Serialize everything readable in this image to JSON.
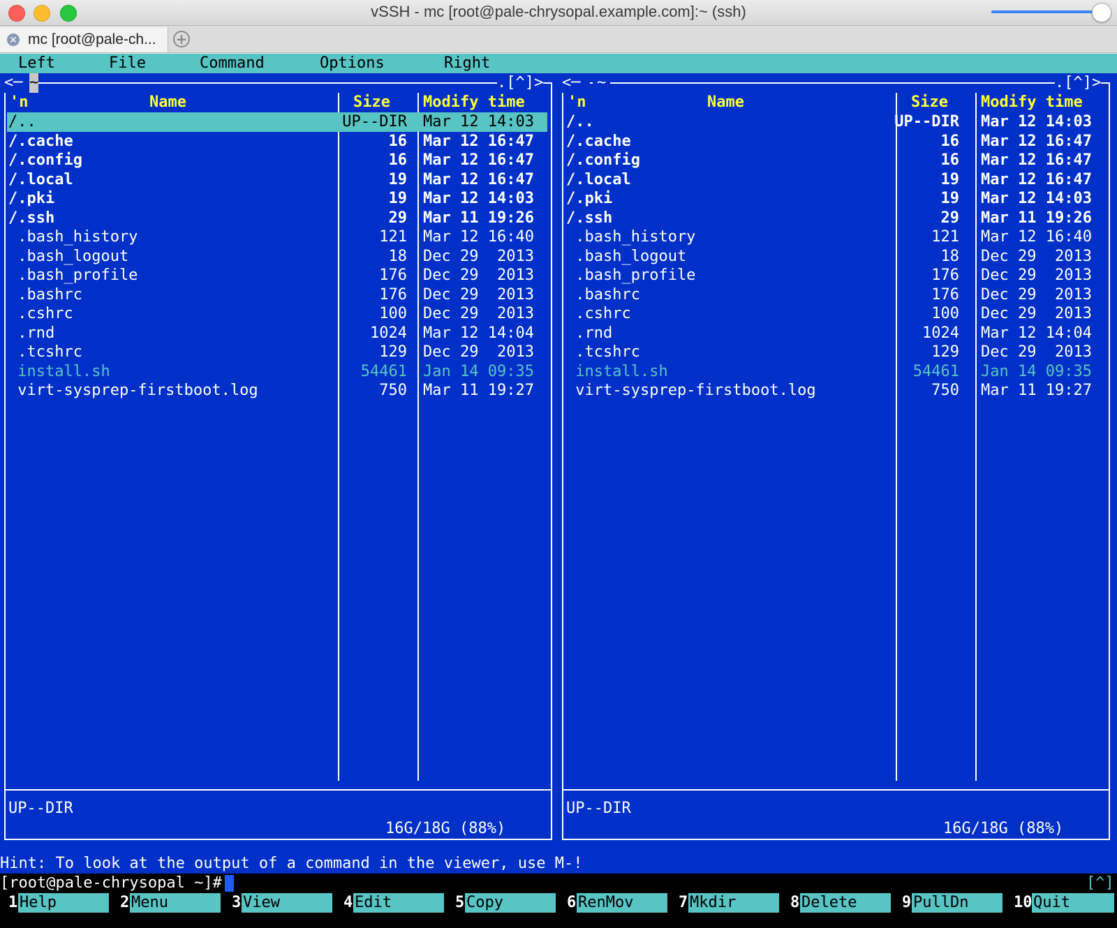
{
  "window": {
    "title": "vSSH - mc [root@pale-chrysopal.example.com]:~ (ssh)"
  },
  "tabs": [
    {
      "label": "mc [root@pale-ch..."
    }
  ],
  "menu": [
    "Left",
    "File",
    "Command",
    "Options",
    "Right"
  ],
  "panels": {
    "left": {
      "path": "~",
      "corner": ".[^]>",
      "headers": {
        "sort": "'n",
        "name": "Name",
        "size": "Size",
        "time": "Modify time"
      },
      "status": "UP--DIR",
      "disk": "16G/18G (88%)"
    },
    "right": {
      "path": "~",
      "corner": ".[^]>",
      "headers": {
        "sort": "'n",
        "name": "Name",
        "size": "Size",
        "time": "Modify time"
      },
      "status": "UP--DIR",
      "disk": "16G/18G (88%)"
    }
  },
  "files": [
    {
      "name": "/..",
      "size": "UP--DIR",
      "time": "Mar 12 14:03",
      "type": "updir"
    },
    {
      "name": "/.cache",
      "size": "16",
      "time": "Mar 12 16:47",
      "type": "dir"
    },
    {
      "name": "/.config",
      "size": "16",
      "time": "Mar 12 16:47",
      "type": "dir"
    },
    {
      "name": "/.local",
      "size": "19",
      "time": "Mar 12 16:47",
      "type": "dir"
    },
    {
      "name": "/.pki",
      "size": "19",
      "time": "Mar 12 14:03",
      "type": "dir"
    },
    {
      "name": "/.ssh",
      "size": "29",
      "time": "Mar 11 19:26",
      "type": "dir"
    },
    {
      "name": " .bash_history",
      "size": "121",
      "time": "Mar 12 16:40",
      "type": "file"
    },
    {
      "name": " .bash_logout",
      "size": "18",
      "time": "Dec 29  2013",
      "type": "file"
    },
    {
      "name": " .bash_profile",
      "size": "176",
      "time": "Dec 29  2013",
      "type": "file"
    },
    {
      "name": " .bashrc",
      "size": "176",
      "time": "Dec 29  2013",
      "type": "file"
    },
    {
      "name": " .cshrc",
      "size": "100",
      "time": "Dec 29  2013",
      "type": "file"
    },
    {
      "name": " .rnd",
      "size": "1024",
      "time": "Mar 12 14:04",
      "type": "file"
    },
    {
      "name": " .tcshrc",
      "size": "129",
      "time": "Dec 29  2013",
      "type": "file"
    },
    {
      "name": " install.sh",
      "size": "54461",
      "time": "Jan 14 09:35",
      "type": "exec"
    },
    {
      "name": " virt-sysprep-firstboot.log",
      "size": "750",
      "time": "Mar 11 19:27",
      "type": "file"
    }
  ],
  "hint": "Hint: To look at the output of a command in the viewer, use M-!",
  "prompt": "[root@pale-chrysopal ~]#",
  "prompt_corner": "[^]",
  "fkeys": [
    {
      "num": "1",
      "label": "Help"
    },
    {
      "num": "2",
      "label": "Menu"
    },
    {
      "num": "3",
      "label": "View"
    },
    {
      "num": "4",
      "label": "Edit"
    },
    {
      "num": "5",
      "label": "Copy"
    },
    {
      "num": "6",
      "label": "RenMov"
    },
    {
      "num": "7",
      "label": "Mkdir"
    },
    {
      "num": "8",
      "label": "Delete"
    },
    {
      "num": "9",
      "label": "PullDn"
    },
    {
      "num": "10",
      "label": "Quit"
    }
  ],
  "colors": {
    "panel_bg": "#0030c8",
    "accent_cyan": "#58c4c4",
    "header_yellow": "#ffff3a"
  }
}
